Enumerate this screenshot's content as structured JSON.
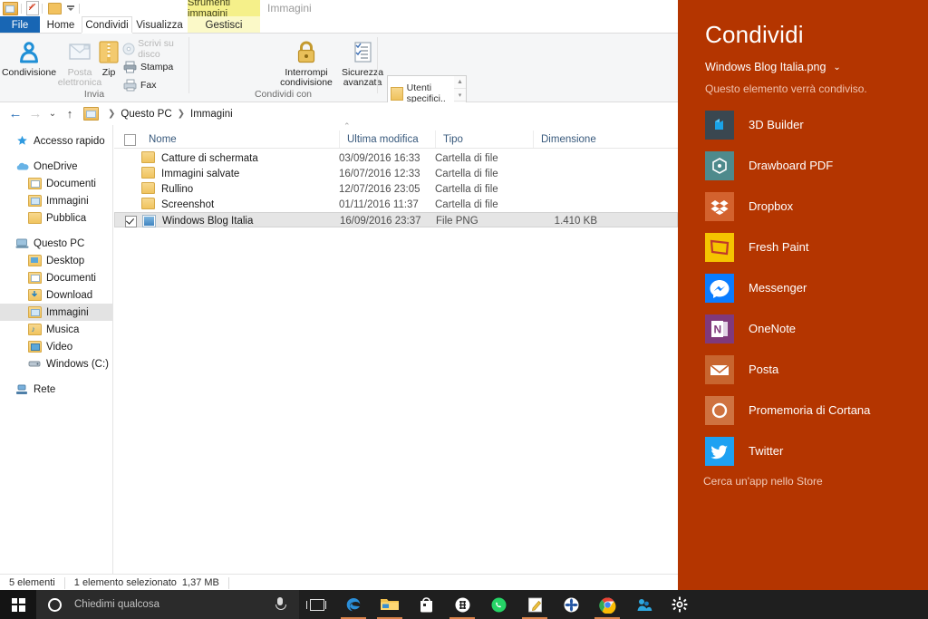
{
  "window": {
    "quick_access": [
      "properties-icon",
      "check-properties-icon",
      "new-folder-icon",
      "customize-dropdown-icon"
    ],
    "contextual_tools": "Strumenti immagini",
    "window_title": "Immagini"
  },
  "tabs": [
    {
      "label": "File",
      "state": "file"
    },
    {
      "label": "Home",
      "state": "normal"
    },
    {
      "label": "Condividi",
      "state": "active"
    },
    {
      "label": "Visualizza",
      "state": "normal"
    },
    {
      "label": "Gestisci",
      "state": "contextual"
    }
  ],
  "ribbon": {
    "groups": [
      {
        "label": "Invia",
        "big_buttons": [
          {
            "label": "Condivisione",
            "icon": "share-icon",
            "enabled": true
          },
          {
            "label": "Posta elettronica",
            "icon": "email-icon",
            "enabled": false
          },
          {
            "label": "Zip",
            "icon": "zip-icon",
            "enabled": true
          }
        ],
        "small_items": [
          {
            "label": "Scrivi su disco",
            "icon": "burn-disc-icon",
            "enabled": false
          },
          {
            "label": "Stampa",
            "icon": "printer-icon",
            "enabled": true
          },
          {
            "label": "Fax",
            "icon": "fax-icon",
            "enabled": true
          }
        ]
      },
      {
        "label": "Condividi con",
        "share_with_value": "Utenti specifici..",
        "big_buttons": [
          {
            "label": "Interrompi condivisione",
            "icon": "lock-icon",
            "enabled": true
          },
          {
            "label": "Sicurezza avanzata",
            "icon": "advanced-security-icon",
            "enabled": true
          }
        ]
      }
    ]
  },
  "address_bar": {
    "back": "←",
    "forward": "→",
    "recent": "⌄",
    "up": "↑",
    "breadcrumbs": [
      "Questo PC",
      "Immagini"
    ]
  },
  "nav_pane": [
    {
      "label": "Accesso rapido",
      "icon": "star-pin-icon",
      "indent": false,
      "selected": false
    },
    {
      "label": "OneDrive",
      "icon": "onedrive-cloud-icon",
      "indent": false,
      "selected": false,
      "spacer_before": true
    },
    {
      "label": "Documenti",
      "icon": "documents-folder-icon",
      "indent": true,
      "selected": false
    },
    {
      "label": "Immagini",
      "icon": "pictures-folder-icon",
      "indent": true,
      "selected": false
    },
    {
      "label": "Pubblica",
      "icon": "folder-icon",
      "indent": true,
      "selected": false
    },
    {
      "label": "Questo PC",
      "icon": "this-pc-icon",
      "indent": false,
      "selected": false,
      "spacer_before": true
    },
    {
      "label": "Desktop",
      "icon": "desktop-folder-icon",
      "indent": true,
      "selected": false
    },
    {
      "label": "Documenti",
      "icon": "documents-folder-icon",
      "indent": true,
      "selected": false
    },
    {
      "label": "Download",
      "icon": "download-folder-icon",
      "indent": true,
      "selected": false
    },
    {
      "label": "Immagini",
      "icon": "pictures-folder-icon",
      "indent": true,
      "selected": true
    },
    {
      "label": "Musica",
      "icon": "music-folder-icon",
      "indent": true,
      "selected": false
    },
    {
      "label": "Video",
      "icon": "video-folder-icon",
      "indent": true,
      "selected": false
    },
    {
      "label": "Windows (C:)",
      "icon": "hard-disk-icon",
      "indent": true,
      "selected": false
    },
    {
      "label": "Rete",
      "icon": "network-icon",
      "indent": false,
      "selected": false,
      "spacer_before": true
    }
  ],
  "file_list": {
    "columns": [
      "Nome",
      "Ultima modifica",
      "Tipo",
      "Dimensione"
    ],
    "sort_column": "Nome",
    "sort_direction": "ascending",
    "rows": [
      {
        "name": "Catture di schermata",
        "modified": "03/09/2016 16:33",
        "type": "Cartella di file",
        "size": "",
        "icon": "folder-icon",
        "selected": false,
        "checked": false
      },
      {
        "name": "Immagini salvate",
        "modified": "16/07/2016 12:33",
        "type": "Cartella di file",
        "size": "",
        "icon": "folder-icon",
        "selected": false,
        "checked": false
      },
      {
        "name": "Rullino",
        "modified": "12/07/2016 23:05",
        "type": "Cartella di file",
        "size": "",
        "icon": "folder-icon",
        "selected": false,
        "checked": false
      },
      {
        "name": "Screenshot",
        "modified": "01/11/2016 11:37",
        "type": "Cartella di file",
        "size": "",
        "icon": "folder-icon",
        "selected": false,
        "checked": false
      },
      {
        "name": "Windows Blog Italia",
        "modified": "16/09/2016 23:37",
        "type": "File PNG",
        "size": "1.410 KB",
        "icon": "png-file-icon",
        "selected": true,
        "checked": true
      }
    ]
  },
  "status_bar": {
    "count": "5 elementi",
    "selection": "1 elemento selezionato",
    "selection_size": "1,37 MB"
  },
  "share_panel": {
    "accent_color": "#b43500",
    "title": "Condividi",
    "file_name": "Windows Blog Italia.png",
    "chevron": "⌄",
    "subtitle": "Questo elemento verrà condiviso.",
    "apps": [
      {
        "label": "3D Builder",
        "icon": "3d-builder-icon",
        "tile": "t-3d"
      },
      {
        "label": "Drawboard PDF",
        "icon": "drawboard-pdf-icon",
        "tile": "t-draw"
      },
      {
        "label": "Dropbox",
        "icon": "dropbox-icon",
        "tile": "t-drop"
      },
      {
        "label": "Fresh Paint",
        "icon": "fresh-paint-icon",
        "tile": "t-fresh"
      },
      {
        "label": "Messenger",
        "icon": "messenger-icon",
        "tile": "t-msg"
      },
      {
        "label": "OneNote",
        "icon": "onenote-icon",
        "tile": "t-one"
      },
      {
        "label": "Posta",
        "icon": "mail-icon",
        "tile": "t-posta"
      },
      {
        "label": "Promemoria di Cortana",
        "icon": "cortana-icon",
        "tile": "t-cort"
      },
      {
        "label": "Twitter",
        "icon": "twitter-icon",
        "tile": "t-twit"
      }
    ],
    "store_link": "Cerca un'app nello Store"
  },
  "taskbar": {
    "start": "windows-start-icon",
    "search_placeholder": "Chiedimi qualcosa",
    "cortana": "cortana-ring-icon",
    "mic": "microphone-icon",
    "task_view": "task-view-icon",
    "apps": [
      {
        "name": "edge-icon",
        "running": true
      },
      {
        "name": "file-explorer-icon",
        "running": true
      },
      {
        "name": "microsoft-store-icon",
        "running": false
      },
      {
        "name": "app-dark-icon",
        "running": true
      },
      {
        "name": "whatsapp-icon",
        "running": false
      },
      {
        "name": "notepad-pencil-icon",
        "running": true
      },
      {
        "name": "blue-flower-icon",
        "running": false
      },
      {
        "name": "chrome-icon",
        "running": true
      },
      {
        "name": "blue-app-icon",
        "running": false
      },
      {
        "name": "settings-gear-icon",
        "running": false
      }
    ]
  }
}
